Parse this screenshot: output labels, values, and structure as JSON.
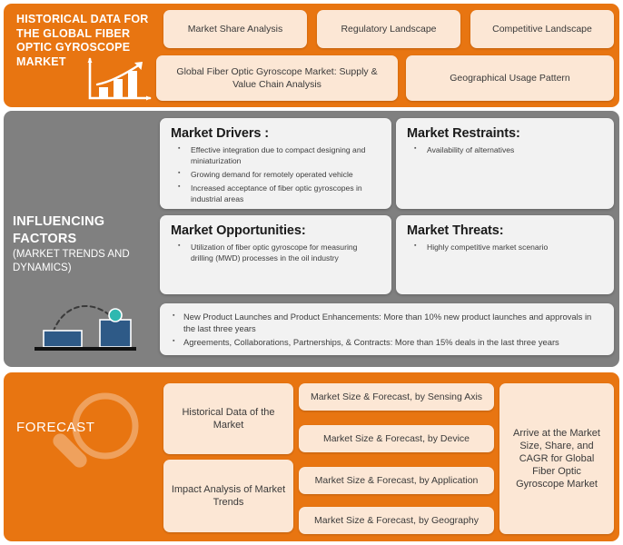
{
  "colors": {
    "orange": "#E87511",
    "gray": "#808080",
    "peach": "#FCE7D5",
    "card_white": "#F2F2F2",
    "text_dark": "#3A3A3A",
    "white": "#FFFFFF",
    "icon_blue": "#2E5A87",
    "icon_teal": "#2EB8B0"
  },
  "historical": {
    "title_lines": "HISTORICAL DATA FOR THE GLOBAL FIBER OPTIC GYROSCOPE MARKET",
    "icon": "bar-chart-growth-icon",
    "row1": [
      {
        "label": "Market Share Analysis"
      },
      {
        "label": "Regulatory Landscape"
      },
      {
        "label": "Competitive Landscape"
      }
    ],
    "row2": [
      {
        "label": "Global Fiber Optic Gyroscope Market: Supply & Value Chain Analysis"
      },
      {
        "label": "Geographical Usage Pattern"
      }
    ]
  },
  "influencing": {
    "title": "INFLUENCING FACTORS",
    "subtitle": "(MARKET TRENDS AND DYNAMICS)",
    "icon": "bouncing-ball-growth-icon",
    "quadrants": [
      {
        "heading": "Market Drivers :",
        "items": [
          "Effective integration due to compact designing and miniaturization",
          "Growing demand for remotely operated vehicle",
          "Increased acceptance of fiber optic gyroscopes in industrial areas"
        ]
      },
      {
        "heading": "Market Restraints:",
        "items": [
          "Availability of alternatives"
        ]
      },
      {
        "heading": "Market Opportunities:",
        "items": [
          "Utilization of fiber optic gyroscope for measuring drilling (MWD) processes in the oil industry"
        ]
      },
      {
        "heading": "Market Threats:",
        "items": [
          "Highly competitive market scenario"
        ]
      }
    ],
    "bottom_strip": [
      "New Product Launches and Product Enhancements: More than 10% new product launches and approvals in the last three years",
      "Agreements, Collaborations, Partnerships, & Contracts: More than 15% deals in the last three years"
    ]
  },
  "forecast": {
    "title": "FORECAST",
    "icon": "magnifier-icon",
    "left_cards": [
      {
        "label": "Historical Data of the Market"
      },
      {
        "label": "Impact Analysis of Market Trends"
      }
    ],
    "middle_cards": [
      {
        "label": "Market Size & Forecast, by Sensing Axis"
      },
      {
        "label": "Market Size & Forecast, by Device"
      },
      {
        "label": "Market Size & Forecast, by Application"
      },
      {
        "label": "Market Size & Forecast, by Geography"
      }
    ],
    "result_card": {
      "label": "Arrive at the Market Size, Share, and CAGR for Global Fiber Optic Gyroscope Market"
    }
  }
}
